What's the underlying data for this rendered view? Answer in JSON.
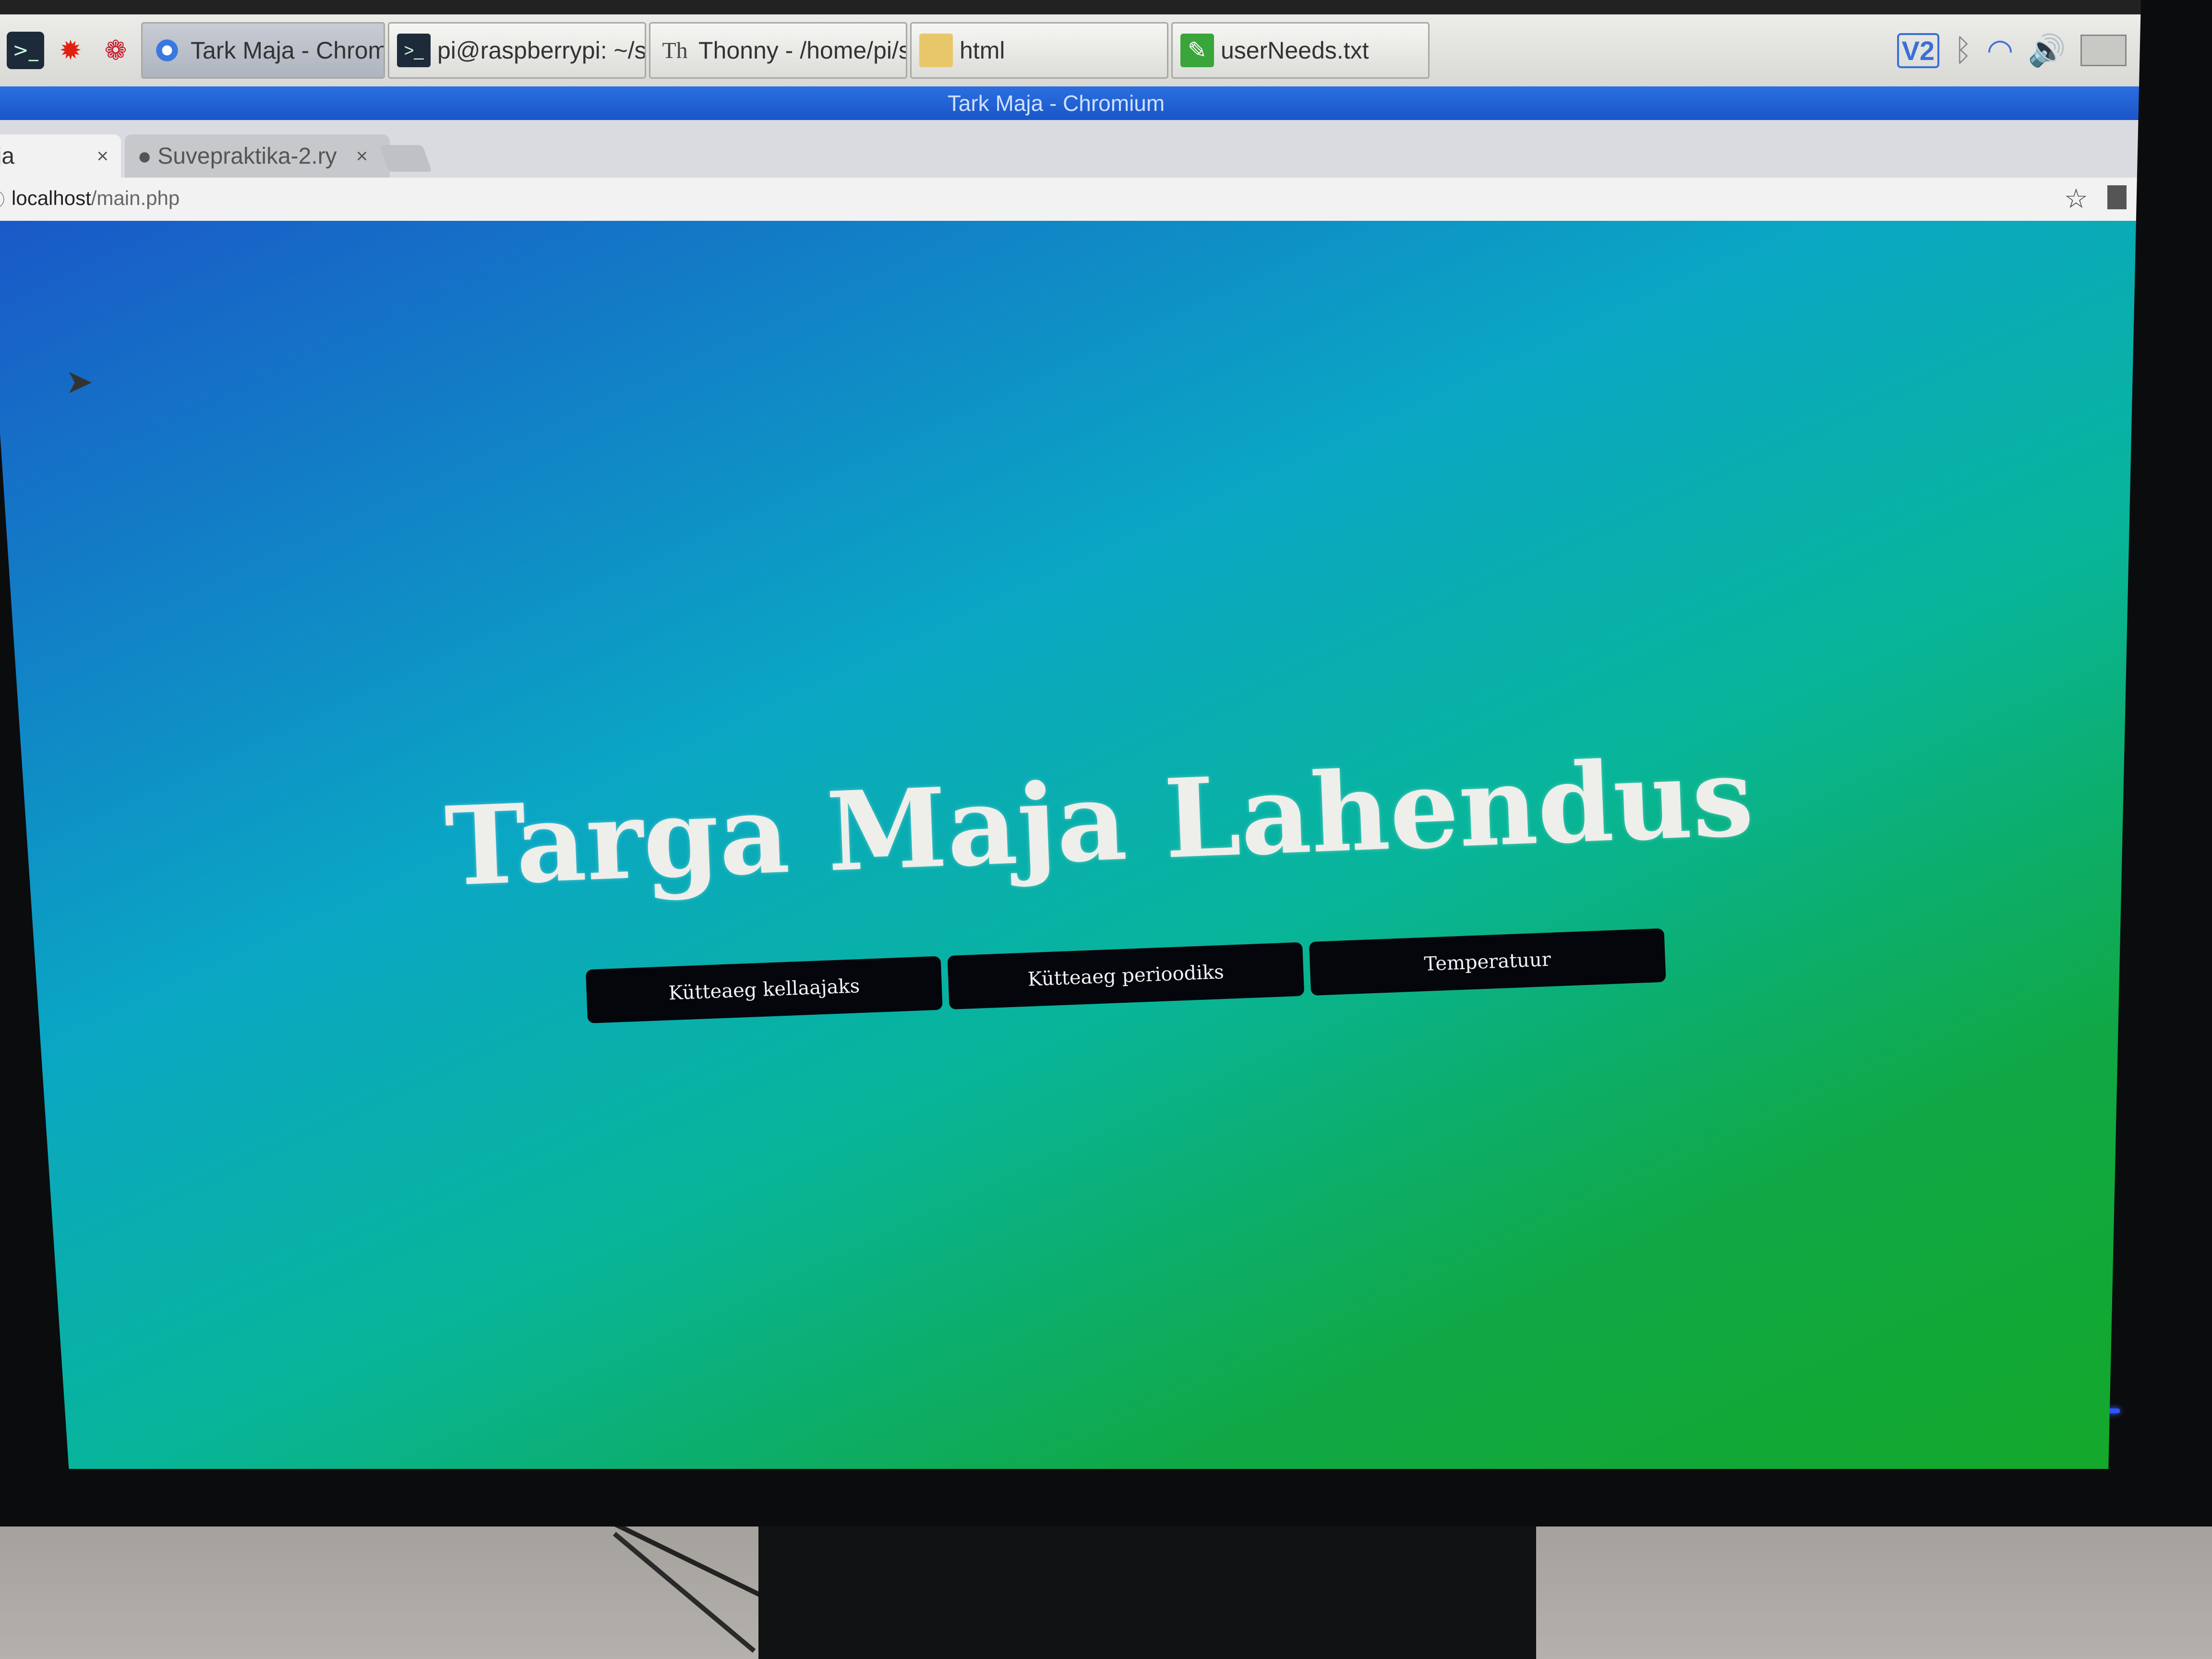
{
  "taskbar": {
    "launchers": [
      "folder-icon",
      "terminal-icon",
      "burst-icon",
      "raspberry-icon"
    ],
    "tasks": [
      {
        "icon": "chromium-icon",
        "label": "Tark Maja - Chromium",
        "active": true
      },
      {
        "icon": "terminal-icon",
        "label": "pi@raspberrypi: ~/su...",
        "active": false
      },
      {
        "icon": "thonny-icon",
        "label": "Thonny  -  /home/pi/s...",
        "active": false
      },
      {
        "icon": "folder-icon",
        "label": "html",
        "active": false
      },
      {
        "icon": "text-file-icon",
        "label": "userNeeds.txt",
        "active": false
      }
    ],
    "tray": {
      "vnc_label": "V2",
      "icons": [
        "bluetooth-icon",
        "wifi-icon",
        "volume-icon",
        "cpu-monitor-icon"
      ]
    }
  },
  "window": {
    "title": "Tark Maja - Chromium"
  },
  "browser": {
    "tabs": [
      {
        "label": "aja",
        "active": true
      },
      {
        "label": "Suvepraktika-2.ry",
        "active": false
      }
    ],
    "url_host": "localhost",
    "url_path": "/main.php"
  },
  "page": {
    "title": "Targa Maja Lahendus",
    "buttons": [
      "Kütteaeg kellaajaks",
      "Kütteaeg perioodiks",
      "Temperatuur"
    ]
  },
  "colors": {
    "gradient_start": "#1a58c8",
    "gradient_mid": "#0aa6c4",
    "gradient_end": "#14a82a",
    "button_bg": "#05060c",
    "title_color": "#eeeeea"
  }
}
